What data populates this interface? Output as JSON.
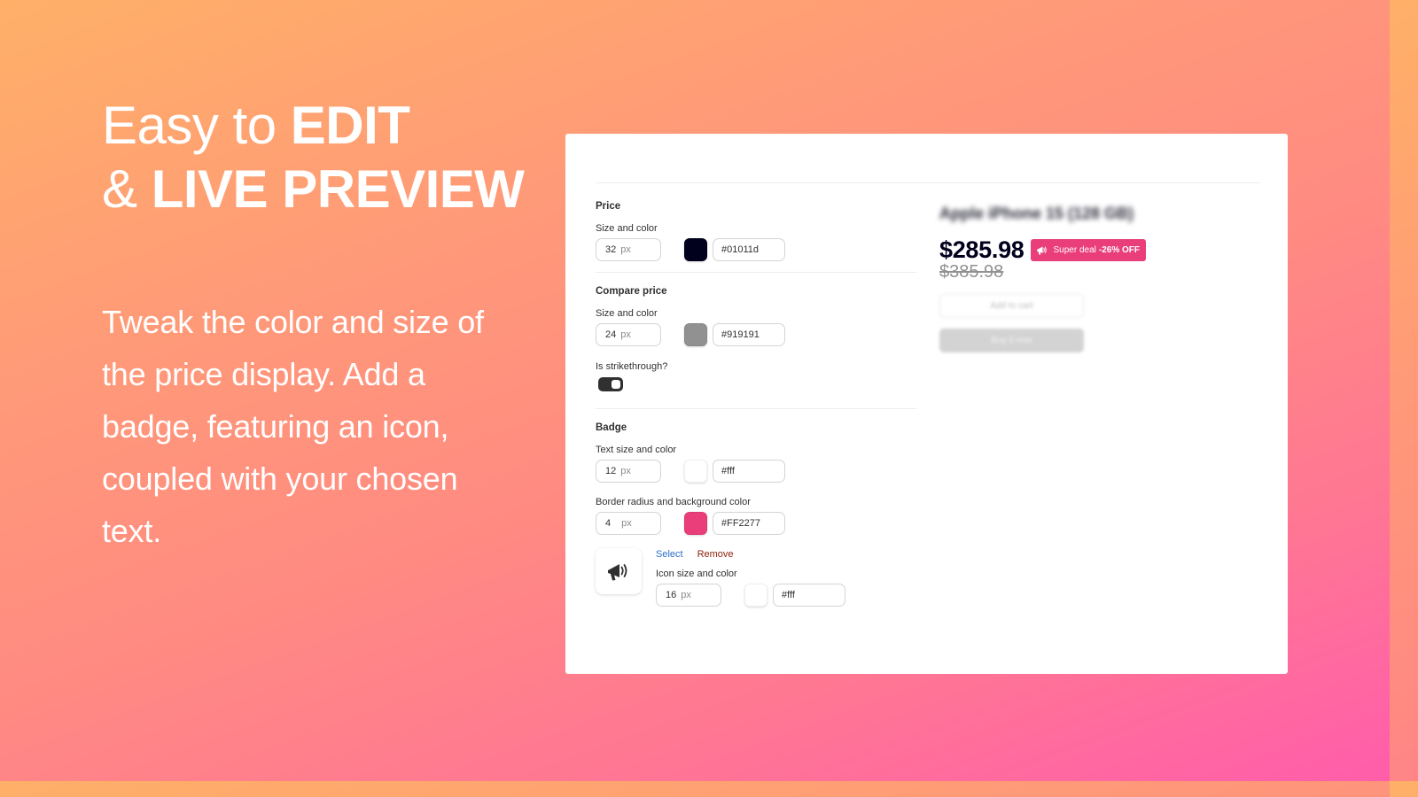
{
  "hero": {
    "headline_line1_light": "Easy to ",
    "headline_line1_bold": "EDIT",
    "headline_line2_light": "& ",
    "headline_line2_bold": "LIVE PREVIEW",
    "description": "Tweak the color and size of the price display. Add a badge, featuring an icon, coupled with your chosen text."
  },
  "colors": {
    "background_gradient": [
      "#FFB068",
      "#FF8A82",
      "#FF5DAA"
    ],
    "panel": "#FFFFFF",
    "badge_bg": "#E93E7A",
    "link_select": "#2C6ECB",
    "link_remove": "#8E1F0B"
  },
  "settings": {
    "price": {
      "title": "Price",
      "label": "Size and color",
      "size": "32",
      "unit": "px",
      "color_swatch": "#01011d",
      "color_hex": "#01011d"
    },
    "compare_price": {
      "title": "Compare price",
      "label": "Size and color",
      "size": "24",
      "unit": "px",
      "color_swatch": "#919191",
      "color_hex": "#919191",
      "strikethrough_label": "Is strikethrough?",
      "strikethrough_on": true
    },
    "badge": {
      "title": "Badge",
      "text_label": "Text size and color",
      "text_size": "12",
      "text_unit": "px",
      "text_color_swatch": "#ffffff",
      "text_color_hex": "#fff",
      "border_label": "Border radius and background color",
      "border_radius": "4",
      "border_unit": "px",
      "bg_color_swatch": "#E93E7A",
      "bg_color_hex": "#FF2277",
      "icon_name": "megaphone-icon",
      "select_label": "Select",
      "remove_label": "Remove",
      "icon_label": "Icon size and color",
      "icon_size": "16",
      "icon_unit": "px",
      "icon_color_swatch": "#ffffff",
      "icon_color_hex": "#fff"
    }
  },
  "preview": {
    "product_title": "Apple iPhone 15 (128 GB)",
    "price": "$285.98",
    "badge_text": "Super deal",
    "badge_bold": "-26% OFF",
    "compare_price": "$385.98",
    "add_to_cart": "Add to cart",
    "buy_now": "Buy it now"
  }
}
